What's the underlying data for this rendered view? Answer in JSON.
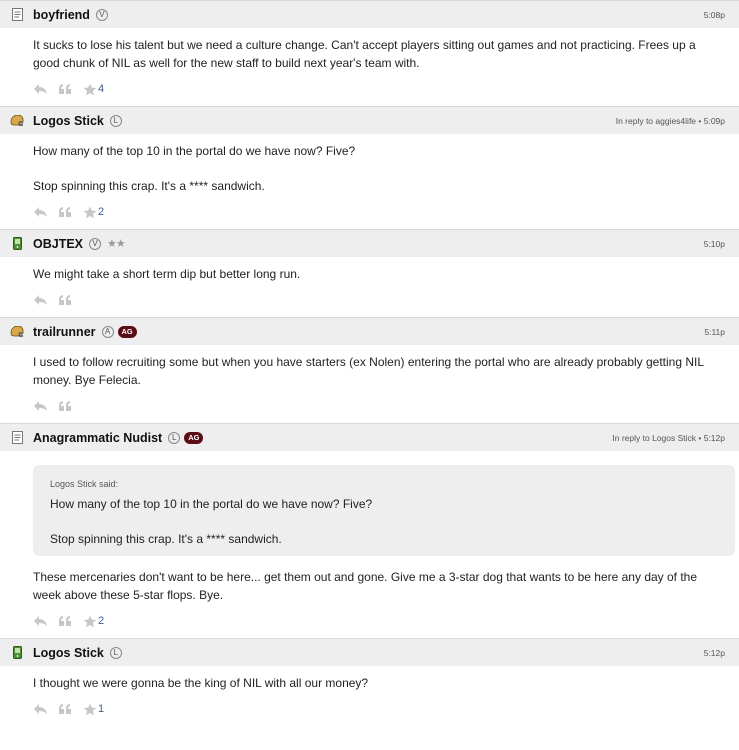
{
  "colors": {
    "header_bg": "#eeeeee",
    "badge_ag": "#5b0b14",
    "count_link": "#3d5d8c",
    "icon_gray": "#c7c7c7"
  },
  "posts": [
    {
      "icon": "document-icon",
      "username": "boyfriend",
      "badge": "V",
      "ag": false,
      "stars": "",
      "meta": "5:08p",
      "paragraphs": [
        "It sucks to lose his talent but we need a culture change. Can't accept players sitting out games and not practicing. Frees up a good chunk of NIL as well for the new staff to build next year's team with."
      ],
      "star_count": "4"
    },
    {
      "icon": "football-helmet-icon",
      "username": "Logos Stick",
      "badge": "L",
      "ag": false,
      "stars": "",
      "meta": "In reply to aggies4life • 5:09p",
      "paragraphs": [
        "How many of the top 10 in the portal do we have now? Five?",
        "Stop spinning this crap. It's a **** sandwich."
      ],
      "star_count": "2"
    },
    {
      "icon": "phone-icon",
      "username": "OBJTEX",
      "badge": "V",
      "ag": false,
      "stars": "★★",
      "meta": "5:10p",
      "paragraphs": [
        "We might take a short term dip but better long run."
      ],
      "star_count": ""
    },
    {
      "icon": "football-helmet-icon",
      "username": "trailrunner",
      "badge": "A",
      "ag": true,
      "ag_label": "AG",
      "stars": "",
      "meta": "5:11p",
      "paragraphs": [
        "I used to follow recruiting some but when you have starters (ex Nolen) entering the portal who are already probably getting NIL money. Bye Felecia."
      ],
      "star_count": ""
    },
    {
      "icon": "document-icon",
      "username": "Anagrammatic Nudist",
      "badge": "L",
      "ag": true,
      "ag_label": "AG",
      "stars": "",
      "meta": "In reply to Logos Stick • 5:12p",
      "quote": {
        "said": "Logos Stick said:",
        "paragraphs": [
          "How many of the top 10 in the portal do we have now? Five?",
          "Stop spinning this crap. It's a **** sandwich."
        ]
      },
      "paragraphs": [
        "These mercenaries don't want to be here... get them out and gone. Give me a 3-star dog that wants to be here any day of the week above these 5-star flops. Bye."
      ],
      "star_count": "2"
    },
    {
      "icon": "phone-icon",
      "username": "Logos Stick",
      "badge": "L",
      "ag": false,
      "stars": "",
      "meta": "5:12p",
      "paragraphs": [
        "I thought we were gonna be the king of NIL with all our money?"
      ],
      "star_count": "1"
    }
  ]
}
